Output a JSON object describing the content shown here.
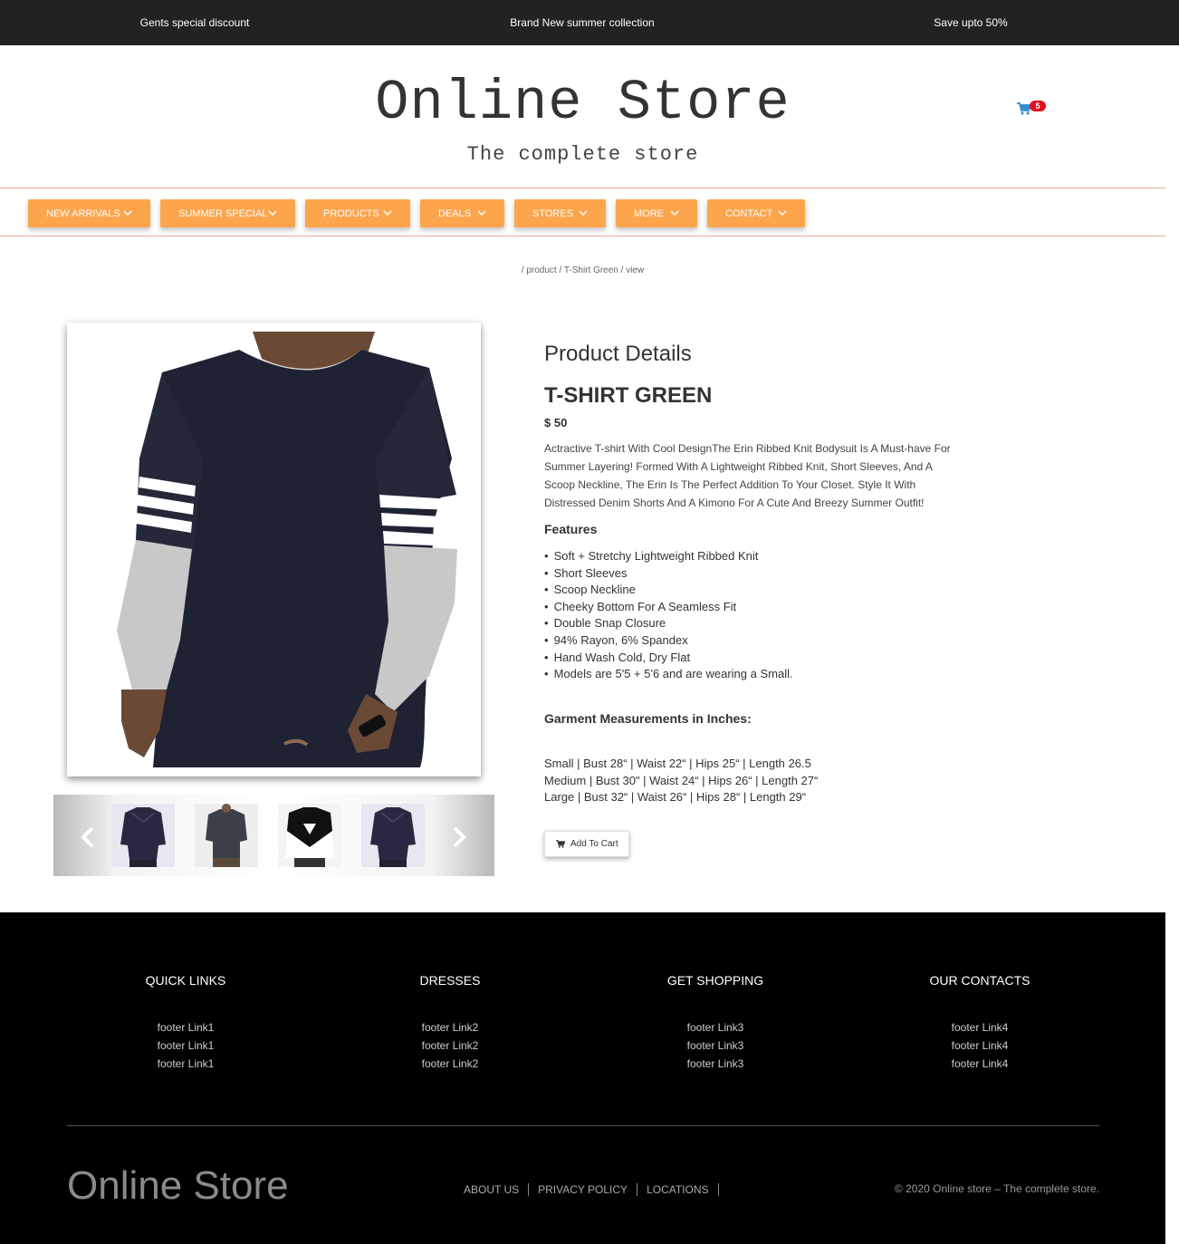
{
  "topbar": {
    "left": "Gents special discount",
    "center": "Brand New summer collection",
    "right": "Save upto 50%"
  },
  "header": {
    "title": "Online Store",
    "tagline": "The complete store",
    "cart_count": "5",
    "cart_icon": "shopping-cart-icon"
  },
  "nav": {
    "items": [
      {
        "label": "NEW ARRIVALS"
      },
      {
        "label": "SUMMER SPECIAL"
      },
      {
        "label": "PRODUCTS"
      },
      {
        "label": "DEALS"
      },
      {
        "label": "STORES"
      },
      {
        "label": "MORE"
      },
      {
        "label": "CONTACT"
      }
    ],
    "color": "#fda54d"
  },
  "breadcrumb": "/ product / T-Shirt Green / view",
  "product": {
    "section_heading": "Product Details",
    "name": "T-SHIRT GREEN",
    "price": "$ 50",
    "description": "Actractive T-shirt With Cool DesignThe Erin Ribbed Knit Bodysuit Is A Must-have For Summer Layering! Formed With A Lightweight Ribbed Knit, Short Sleeves, And A Scoop Neckline, The Erin Is The Perfect Addition To Your Closet. Style It With Distressed Denim Shorts And A Kimono For A Cute And Breezy Summer Outfit!",
    "features_heading": "Features",
    "features": [
      "Soft + Stretchy Lightweight Ribbed Knit",
      "Short Sleeves",
      "Scoop Neckline",
      "Cheeky Bottom For A Seamless Fit",
      "Double Snap Closure",
      "94% Rayon, 6% Spandex",
      "Hand Wash Cold, Dry Flat",
      "Models are 5'5 + 5'6 and are wearing a Small."
    ],
    "measurements_heading": "Garment Measurements in Inches:",
    "measurements": [
      "Small | Bust 28“ | Waist 22“ | Hips 25“ | Length 26.5",
      "Medium | Bust 30\" | Waist 24“ | Hips 26“ | Length 27“",
      "Large | Bust 32“ | Waist 26“ | Hips 28“ | Length 29“"
    ],
    "add_to_cart": "Add To Cart"
  },
  "footer": {
    "columns": [
      {
        "heading": "QUICK LINKS",
        "links": [
          "footer Link1",
          "footer Link1",
          "footer Link1"
        ]
      },
      {
        "heading": "DRESSES",
        "links": [
          "footer Link2",
          "footer Link2",
          "footer Link2"
        ]
      },
      {
        "heading": "GET SHOPPING",
        "links": [
          "footer Link3",
          "footer Link3",
          "footer Link3"
        ]
      },
      {
        "heading": "OUR CONTACTS",
        "links": [
          "footer Link4",
          "footer Link4",
          "footer Link4"
        ]
      }
    ],
    "brand": "Online Store",
    "links": [
      "ABOUT US",
      "PRIVACY POLICY",
      "LOCATIONS"
    ],
    "copyright": "© 2020 Online store – The complete store."
  }
}
